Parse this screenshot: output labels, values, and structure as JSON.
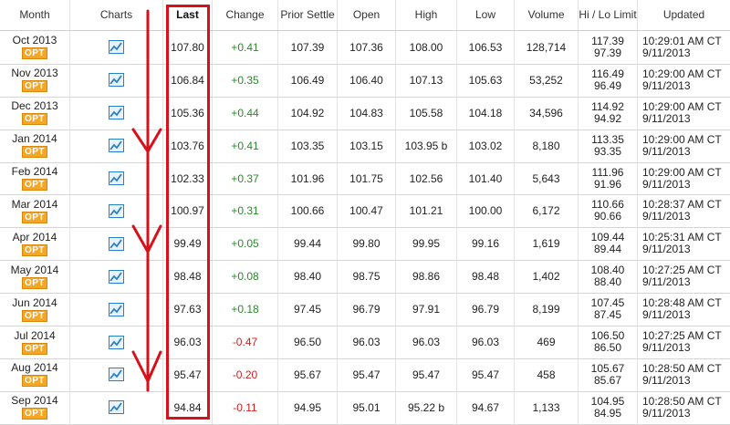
{
  "headers": {
    "month": "Month",
    "charts": "Charts",
    "last": "Last",
    "change": "Change",
    "prior_settle": "Prior Settle",
    "open": "Open",
    "high": "High",
    "low": "Low",
    "volume": "Volume",
    "hilo": "Hi / Lo Limit",
    "updated": "Updated"
  },
  "opt_label": "OPT",
  "colors": {
    "positive": "#2a8a2a",
    "negative": "#cc2222",
    "annotation": "#d8101a",
    "opt_badge": "#f5a623",
    "chart_icon": "#2a7fc9"
  },
  "rows": [
    {
      "month": "Oct 2013",
      "last": "107.80",
      "change": "+0.41",
      "prior": "107.39",
      "open": "107.36",
      "high": "108.00",
      "low": "106.53",
      "volume": "128,714",
      "hi": "117.39",
      "lo": "97.39",
      "time": "10:29:01 AM CT",
      "date": "9/11/2013"
    },
    {
      "month": "Nov 2013",
      "last": "106.84",
      "change": "+0.35",
      "prior": "106.49",
      "open": "106.40",
      "high": "107.13",
      "low": "105.63",
      "volume": "53,252",
      "hi": "116.49",
      "lo": "96.49",
      "time": "10:29:00 AM CT",
      "date": "9/11/2013"
    },
    {
      "month": "Dec 2013",
      "last": "105.36",
      "change": "+0.44",
      "prior": "104.92",
      "open": "104.83",
      "high": "105.58",
      "low": "104.18",
      "volume": "34,596",
      "hi": "114.92",
      "lo": "94.92",
      "time": "10:29:00 AM CT",
      "date": "9/11/2013"
    },
    {
      "month": "Jan 2014",
      "last": "103.76",
      "change": "+0.41",
      "prior": "103.35",
      "open": "103.15",
      "high": "103.95 b",
      "low": "103.02",
      "volume": "8,180",
      "hi": "113.35",
      "lo": "93.35",
      "time": "10:29:00 AM CT",
      "date": "9/11/2013"
    },
    {
      "month": "Feb 2014",
      "last": "102.33",
      "change": "+0.37",
      "prior": "101.96",
      "open": "101.75",
      "high": "102.56",
      "low": "101.40",
      "volume": "5,643",
      "hi": "111.96",
      "lo": "91.96",
      "time": "10:29:00 AM CT",
      "date": "9/11/2013"
    },
    {
      "month": "Mar 2014",
      "last": "100.97",
      "change": "+0.31",
      "prior": "100.66",
      "open": "100.47",
      "high": "101.21",
      "low": "100.00",
      "volume": "6,172",
      "hi": "110.66",
      "lo": "90.66",
      "time": "10:28:37 AM CT",
      "date": "9/11/2013"
    },
    {
      "month": "Apr 2014",
      "last": "99.49",
      "change": "+0.05",
      "prior": "99.44",
      "open": "99.80",
      "high": "99.95",
      "low": "99.16",
      "volume": "1,619",
      "hi": "109.44",
      "lo": "89.44",
      "time": "10:25:31 AM CT",
      "date": "9/11/2013"
    },
    {
      "month": "May 2014",
      "last": "98.48",
      "change": "+0.08",
      "prior": "98.40",
      "open": "98.75",
      "high": "98.86",
      "low": "98.48",
      "volume": "1,402",
      "hi": "108.40",
      "lo": "88.40",
      "time": "10:27:25 AM CT",
      "date": "9/11/2013"
    },
    {
      "month": "Jun 2014",
      "last": "97.63",
      "change": "+0.18",
      "prior": "97.45",
      "open": "96.79",
      "high": "97.91",
      "low": "96.79",
      "volume": "8,199",
      "hi": "107.45",
      "lo": "87.45",
      "time": "10:28:48 AM CT",
      "date": "9/11/2013"
    },
    {
      "month": "Jul 2014",
      "last": "96.03",
      "change": "-0.47",
      "prior": "96.50",
      "open": "96.03",
      "high": "96.03",
      "low": "96.03",
      "volume": "469",
      "hi": "106.50",
      "lo": "86.50",
      "time": "10:27:25 AM CT",
      "date": "9/11/2013"
    },
    {
      "month": "Aug 2014",
      "last": "95.47",
      "change": "-0.20",
      "prior": "95.67",
      "open": "95.47",
      "high": "95.47",
      "low": "95.47",
      "volume": "458",
      "hi": "105.67",
      "lo": "85.67",
      "time": "10:28:50 AM CT",
      "date": "9/11/2013"
    },
    {
      "month": "Sep 2014",
      "last": "94.84",
      "change": "-0.11",
      "prior": "94.95",
      "open": "95.01",
      "high": "95.22 b",
      "low": "94.67",
      "volume": "1,133",
      "hi": "104.95",
      "lo": "84.95",
      "time": "10:28:50 AM CT",
      "date": "9/11/2013"
    }
  ]
}
